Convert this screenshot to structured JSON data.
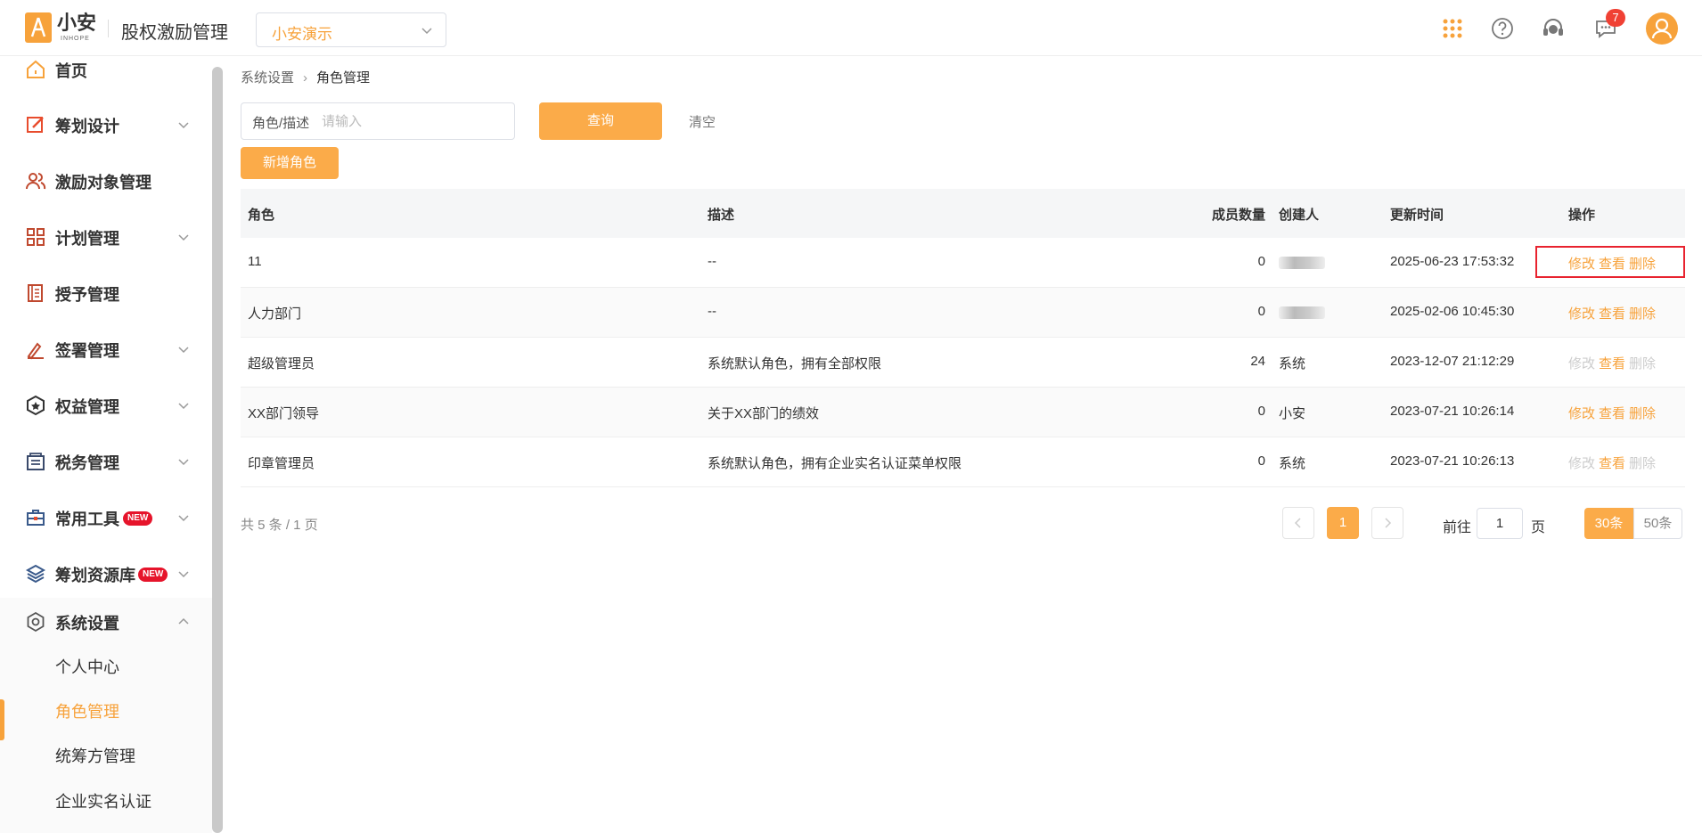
{
  "header": {
    "logo_text": "小安",
    "logo_sub": "INHOPE",
    "app_title": "股权激励管理",
    "company": "小安演示",
    "message_count": "7"
  },
  "sidebar": {
    "items": [
      {
        "label": "首页",
        "icon": "home-icon"
      },
      {
        "label": "筹划设计",
        "icon": "edit-icon"
      },
      {
        "label": "激励对象管理",
        "icon": "users-icon"
      },
      {
        "label": "计划管理",
        "icon": "grid-icon"
      },
      {
        "label": "授予管理",
        "icon": "book-icon"
      },
      {
        "label": "签署管理",
        "icon": "sign-icon"
      },
      {
        "label": "权益管理",
        "icon": "badge-icon"
      },
      {
        "label": "税务管理",
        "icon": "tax-icon"
      },
      {
        "label": "常用工具",
        "icon": "toolbox-icon",
        "tag": "NEW"
      },
      {
        "label": "筹划资源库",
        "icon": "layers-icon",
        "tag": "NEW"
      },
      {
        "label": "系统设置",
        "icon": "settings-icon"
      }
    ],
    "sub_items": [
      "个人中心",
      "角色管理",
      "统筹方管理",
      "企业实名认证"
    ]
  },
  "breadcrumb": {
    "parent": "系统设置",
    "current": "角色管理"
  },
  "filter": {
    "label": "角色/描述",
    "placeholder": "请输入",
    "query": "查询",
    "clear": "清空",
    "add": "新增角色"
  },
  "table": {
    "columns": [
      "角色",
      "描述",
      "成员数量",
      "创建人",
      "更新时间",
      "操作"
    ],
    "actions": [
      "修改",
      "查看",
      "删除"
    ],
    "rows": [
      {
        "role": "11",
        "desc": "--",
        "count": "0",
        "creator": "",
        "updated": "2025-06-23 17:53:32",
        "editable": true
      },
      {
        "role": "人力部门",
        "desc": "--",
        "count": "0",
        "creator": "",
        "updated": "2025-02-06 10:45:30",
        "editable": true
      },
      {
        "role": "超级管理员",
        "desc": "系统默认角色，拥有全部权限",
        "count": "24",
        "creator": "系统",
        "updated": "2023-12-07 21:12:29",
        "editable": false
      },
      {
        "role": "XX部门领导",
        "desc": "关于XX部门的绩效",
        "count": "0",
        "creator": "小安",
        "updated": "2023-07-21 10:26:14",
        "editable": true
      },
      {
        "role": "印章管理员",
        "desc": "系统默认角色，拥有企业实名认证菜单权限",
        "count": "0",
        "creator": "系统",
        "updated": "2023-07-21 10:26:13",
        "editable": false
      }
    ]
  },
  "pagination": {
    "total": "共 5 条 / 1 页",
    "page": "1",
    "goto_label": "前往",
    "goto_value": "1",
    "goto_unit": "页",
    "size_a": "30条",
    "size_b": "50条"
  },
  "colors": {
    "accent": "#fbab49",
    "highlight": "#e8232f"
  }
}
